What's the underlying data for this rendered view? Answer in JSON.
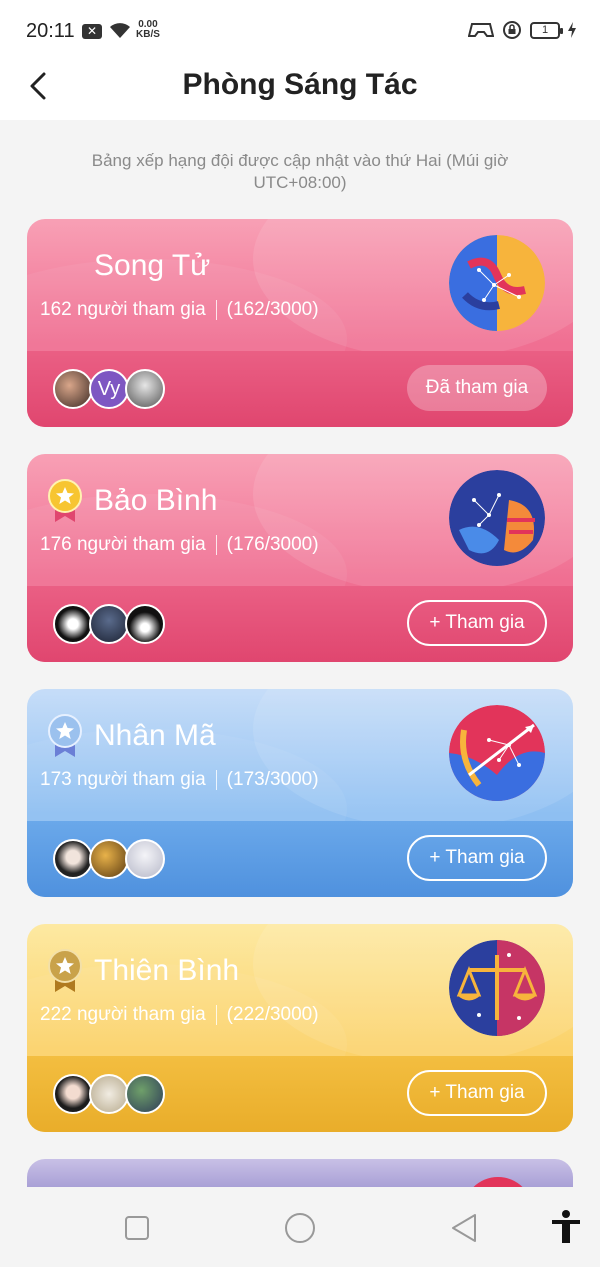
{
  "status": {
    "time": "20:11",
    "speed_value": "0.00",
    "speed_unit": "KB/S",
    "battery": "1"
  },
  "header": {
    "title": "Phòng Sáng Tác"
  },
  "notice": "Bảng xếp hạng đội được cập nhật vào thứ Hai (Múi giờ UTC+08:00)",
  "cards": [
    {
      "name": "Song Tử",
      "members": "162 người tham gia",
      "capacity": "(162/3000)",
      "action": "Đã tham gia",
      "first_avatar_text": "Vy",
      "medal": "none",
      "theme": "pink"
    },
    {
      "name": "Bảo Bình",
      "members": "176 người tham gia",
      "capacity": "(176/3000)",
      "action": "+ Tham gia",
      "medal": "gold",
      "theme": "pink"
    },
    {
      "name": "Nhân Mã",
      "members": "173 người tham gia",
      "capacity": "(173/3000)",
      "action": "+ Tham gia",
      "medal": "silver",
      "theme": "blue"
    },
    {
      "name": "Thiên Bình",
      "members": "222 người tham gia",
      "capacity": "(222/3000)",
      "action": "+ Tham gia",
      "medal": "bronze",
      "theme": "yellow"
    }
  ],
  "colors": {
    "pink": "#f06f92",
    "blue": "#8ebff2",
    "yellow": "#fbd26a",
    "gold": "#f7c531",
    "silver": "#9bc1ee",
    "bronze": "#c9a24a"
  },
  "icons": [
    "back-arrow-icon",
    "wifi-icon",
    "gamepad-icon",
    "lock-icon",
    "battery-icon",
    "square-nav-icon",
    "circle-nav-icon",
    "triangle-back-nav-icon",
    "accessibility-icon"
  ]
}
